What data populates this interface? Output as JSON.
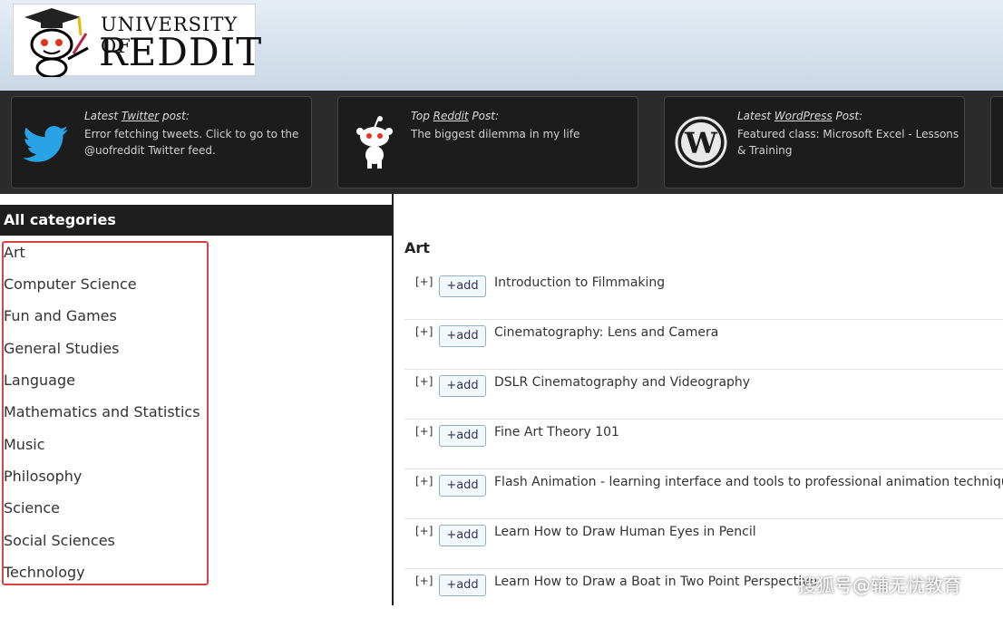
{
  "header": {
    "logo_top": "UNIVERSITY OF",
    "logo_main": "REDDIT"
  },
  "feeds": [
    {
      "icon": "twitter-bird-icon",
      "title_pre": "Latest ",
      "title_link": "Twitter",
      "title_post": " post:",
      "text": "Error fetching tweets. Click to go to the @uofreddit Twitter feed."
    },
    {
      "icon": "reddit-alien-icon",
      "title_pre": "Top ",
      "title_link": "Reddit",
      "title_post": " Post:",
      "text": "The biggest dilemma in my life"
    },
    {
      "icon": "wordpress-icon",
      "title_pre": "Latest ",
      "title_link": "WordPress",
      "title_post": " Post:",
      "text": "Featured class: Microsoft Excel - Lessons & Training"
    }
  ],
  "sidebar": {
    "header": "All categories",
    "categories": [
      "Art",
      "Computer Science",
      "Fun and Games",
      "General Studies",
      "Language",
      "Mathematics and Statistics",
      "Music",
      "Philosophy",
      "Science",
      "Social Sciences",
      "Technology"
    ]
  },
  "main": {
    "section_title": "Art",
    "expand_label": "[+]",
    "add_label": "+add",
    "classes": [
      "Introduction to Filmmaking",
      "Cinematography: Lens and Camera",
      "DSLR Cinematography and Videography",
      "Fine Art Theory 101",
      "Flash Animation - learning interface and tools to professional animation techniques",
      "Learn How to Draw Human Eyes in Pencil",
      "Learn How to Draw a Boat in Two Point Perspective"
    ]
  },
  "watermark": "搜狐号@辅无忧教育",
  "colors": {
    "highlight_box": "#d64545",
    "strip_bg": "#2b2b2b",
    "add_border": "#8fb0cc"
  }
}
